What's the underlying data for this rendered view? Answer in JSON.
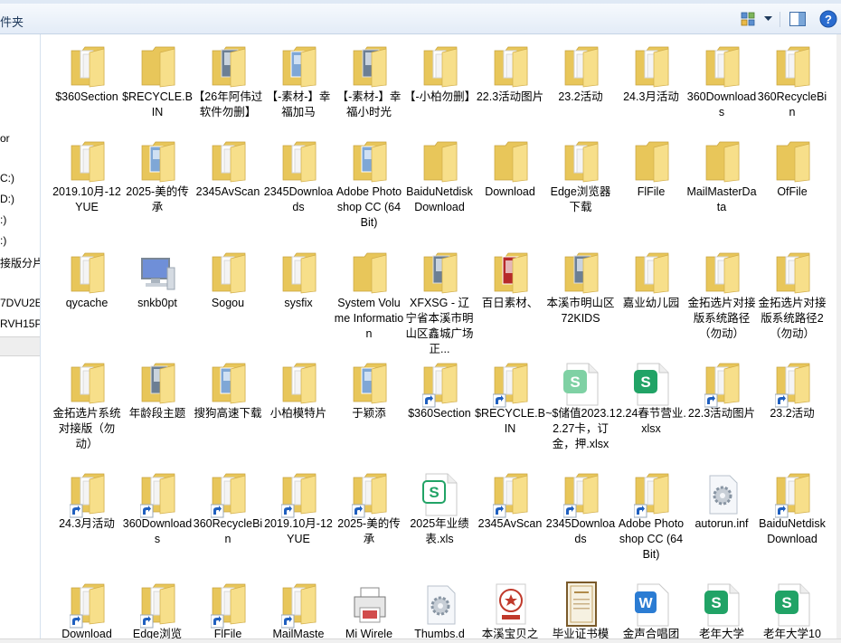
{
  "toolbar": {
    "title_fragment": "件夹"
  },
  "nav": {
    "items": [
      "or",
      "C:)",
      "D:)",
      ":)",
      ":)",
      "接版分片",
      "7DVU2E",
      "RVH15P"
    ]
  },
  "items": [
    {
      "label": "$360Section",
      "icon": "folder-doc"
    },
    {
      "label": "$RECYCLE.BIN",
      "icon": "folder"
    },
    {
      "label": "【26年阿伟过软件勿删】",
      "icon": "folder-photo"
    },
    {
      "label": "【-素材-】幸福加马",
      "icon": "folder-blue"
    },
    {
      "label": "【-素材-】幸福小时光",
      "icon": "folder-photo"
    },
    {
      "label": "【-小柏勿删】",
      "icon": "folder-doc"
    },
    {
      "label": "22.3活动图片",
      "icon": "folder-doc"
    },
    {
      "label": "23.2活动",
      "icon": "folder-doc"
    },
    {
      "label": "24.3月活动",
      "icon": "folder-doc"
    },
    {
      "label": "360Downloads",
      "icon": "folder-doc"
    },
    {
      "label": "360RecycleBin",
      "icon": "folder-doc"
    },
    {
      "label": "2019.10月-12YUE",
      "icon": "folder-doc"
    },
    {
      "label": "2025-美的传承",
      "icon": "folder-blue"
    },
    {
      "label": "2345AvScan",
      "icon": "folder-doc"
    },
    {
      "label": "2345Downloads",
      "icon": "folder-doc"
    },
    {
      "label": "Adobe Photoshop CC (64 Bit)",
      "icon": "folder-blue"
    },
    {
      "label": "BaiduNetdiskDownload",
      "icon": "folder"
    },
    {
      "label": "Download",
      "icon": "folder"
    },
    {
      "label": "Edge浏览器下载",
      "icon": "folder-doc"
    },
    {
      "label": "FlFile",
      "icon": "folder"
    },
    {
      "label": "MailMasterData",
      "icon": "folder"
    },
    {
      "label": "OfFile",
      "icon": "folder"
    },
    {
      "label": "qycache",
      "icon": "folder-doc"
    },
    {
      "label": "snkb0pt",
      "icon": "computer"
    },
    {
      "label": "Sogou",
      "icon": "folder-doc"
    },
    {
      "label": "sysfix",
      "icon": "folder-doc"
    },
    {
      "label": "System Volume Information",
      "icon": "folder"
    },
    {
      "label": "XFXSG - 辽宁省本溪市明山区鑫城广场正...",
      "icon": "folder-photo"
    },
    {
      "label": "百日素材、",
      "icon": "folder-red"
    },
    {
      "label": "本溪市明山区72KIDS",
      "icon": "folder-photo"
    },
    {
      "label": "嘉业幼儿园",
      "icon": "folder-doc"
    },
    {
      "label": "金拓选片对接版系统路径（勿动）",
      "icon": "folder-doc"
    },
    {
      "label": "金拓选片对接版系统路径2（勿动）",
      "icon": "folder-doc"
    },
    {
      "label": "金拓选片系统对接版（勿动）",
      "icon": "folder-doc"
    },
    {
      "label": "年龄段主题",
      "icon": "folder-photo"
    },
    {
      "label": "搜狗高速下载",
      "icon": "folder-blue"
    },
    {
      "label": "小柏模特片",
      "icon": "folder-doc"
    },
    {
      "label": "于颖添",
      "icon": "folder-blue"
    },
    {
      "label": "$360Section",
      "icon": "folder-short"
    },
    {
      "label": "$RECYCLE.BIN",
      "icon": "folder-short"
    },
    {
      "label": "~$储值2023.12.27卡，订金，押.xlsx",
      "icon": "xlsx-light"
    },
    {
      "label": "2.24春节营业.xlsx",
      "icon": "xlsx"
    },
    {
      "label": "22.3活动图片",
      "icon": "folder-short"
    },
    {
      "label": "23.2活动",
      "icon": "folder-short"
    },
    {
      "label": "24.3月活动",
      "icon": "folder-short"
    },
    {
      "label": "360Downloads",
      "icon": "folder-short"
    },
    {
      "label": "360RecycleBin",
      "icon": "folder-short"
    },
    {
      "label": "2019.10月-12YUE",
      "icon": "folder-short"
    },
    {
      "label": "2025-美的传承",
      "icon": "folder-short"
    },
    {
      "label": "2025年业绩表.xls",
      "icon": "xlsx-outline"
    },
    {
      "label": "2345AvScan",
      "icon": "folder-short"
    },
    {
      "label": "2345Downloads",
      "icon": "folder-short"
    },
    {
      "label": "Adobe Photoshop CC (64 Bit)",
      "icon": "folder-short"
    },
    {
      "label": "autorun.inf",
      "icon": "gear-file"
    },
    {
      "label": "BaiduNetdiskDownload",
      "icon": "folder-short"
    },
    {
      "label": "Download",
      "icon": "folder-short"
    },
    {
      "label": "Edge浏览",
      "icon": "folder-short"
    },
    {
      "label": "FlFile",
      "icon": "folder-short"
    },
    {
      "label": "MailMaste",
      "icon": "folder-short"
    },
    {
      "label": "Mi Wirele",
      "icon": "printer"
    },
    {
      "label": "Thumbs.d",
      "icon": "gear-file"
    },
    {
      "label": "本溪宝贝之",
      "icon": "stamp"
    },
    {
      "label": "毕业证书模",
      "icon": "certificate"
    },
    {
      "label": "金声合唱团",
      "icon": "docx"
    },
    {
      "label": "老年大学",
      "icon": "xlsx"
    },
    {
      "label": "老年大学10",
      "icon": "xlsx"
    }
  ],
  "colors": {
    "folder_back": "#e8c65a",
    "folder_front": "#f7df8a",
    "paper": "#ffffff",
    "excel": "#21a366",
    "word": "#2b7cd3",
    "shortcut_arrow": "#1f5fbf"
  }
}
